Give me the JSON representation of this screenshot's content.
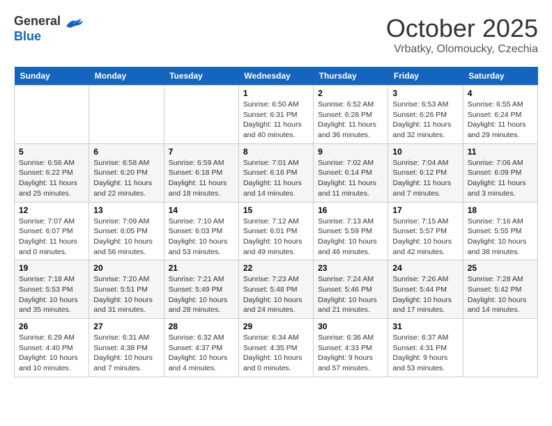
{
  "header": {
    "logo": {
      "general": "General",
      "blue": "Blue"
    },
    "title": "October 2025",
    "subtitle": "Vrbatky, Olomoucky, Czechia"
  },
  "weekdays": [
    "Sunday",
    "Monday",
    "Tuesday",
    "Wednesday",
    "Thursday",
    "Friday",
    "Saturday"
  ],
  "weeks": [
    [
      {
        "day": "",
        "info": ""
      },
      {
        "day": "",
        "info": ""
      },
      {
        "day": "",
        "info": ""
      },
      {
        "day": "1",
        "info": "Sunrise: 6:50 AM\nSunset: 6:31 PM\nDaylight: 11 hours and 40 minutes."
      },
      {
        "day": "2",
        "info": "Sunrise: 6:52 AM\nSunset: 6:28 PM\nDaylight: 11 hours and 36 minutes."
      },
      {
        "day": "3",
        "info": "Sunrise: 6:53 AM\nSunset: 6:26 PM\nDaylight: 11 hours and 32 minutes."
      },
      {
        "day": "4",
        "info": "Sunrise: 6:55 AM\nSunset: 6:24 PM\nDaylight: 11 hours and 29 minutes."
      }
    ],
    [
      {
        "day": "5",
        "info": "Sunrise: 6:56 AM\nSunset: 6:22 PM\nDaylight: 11 hours and 25 minutes."
      },
      {
        "day": "6",
        "info": "Sunrise: 6:58 AM\nSunset: 6:20 PM\nDaylight: 11 hours and 22 minutes."
      },
      {
        "day": "7",
        "info": "Sunrise: 6:59 AM\nSunset: 6:18 PM\nDaylight: 11 hours and 18 minutes."
      },
      {
        "day": "8",
        "info": "Sunrise: 7:01 AM\nSunset: 6:16 PM\nDaylight: 11 hours and 14 minutes."
      },
      {
        "day": "9",
        "info": "Sunrise: 7:02 AM\nSunset: 6:14 PM\nDaylight: 11 hours and 11 minutes."
      },
      {
        "day": "10",
        "info": "Sunrise: 7:04 AM\nSunset: 6:12 PM\nDaylight: 11 hours and 7 minutes."
      },
      {
        "day": "11",
        "info": "Sunrise: 7:06 AM\nSunset: 6:09 PM\nDaylight: 11 hours and 3 minutes."
      }
    ],
    [
      {
        "day": "12",
        "info": "Sunrise: 7:07 AM\nSunset: 6:07 PM\nDaylight: 11 hours and 0 minutes."
      },
      {
        "day": "13",
        "info": "Sunrise: 7:09 AM\nSunset: 6:05 PM\nDaylight: 10 hours and 56 minutes."
      },
      {
        "day": "14",
        "info": "Sunrise: 7:10 AM\nSunset: 6:03 PM\nDaylight: 10 hours and 53 minutes."
      },
      {
        "day": "15",
        "info": "Sunrise: 7:12 AM\nSunset: 6:01 PM\nDaylight: 10 hours and 49 minutes."
      },
      {
        "day": "16",
        "info": "Sunrise: 7:13 AM\nSunset: 5:59 PM\nDaylight: 10 hours and 46 minutes."
      },
      {
        "day": "17",
        "info": "Sunrise: 7:15 AM\nSunset: 5:57 PM\nDaylight: 10 hours and 42 minutes."
      },
      {
        "day": "18",
        "info": "Sunrise: 7:16 AM\nSunset: 5:55 PM\nDaylight: 10 hours and 38 minutes."
      }
    ],
    [
      {
        "day": "19",
        "info": "Sunrise: 7:18 AM\nSunset: 5:53 PM\nDaylight: 10 hours and 35 minutes."
      },
      {
        "day": "20",
        "info": "Sunrise: 7:20 AM\nSunset: 5:51 PM\nDaylight: 10 hours and 31 minutes."
      },
      {
        "day": "21",
        "info": "Sunrise: 7:21 AM\nSunset: 5:49 PM\nDaylight: 10 hours and 28 minutes."
      },
      {
        "day": "22",
        "info": "Sunrise: 7:23 AM\nSunset: 5:48 PM\nDaylight: 10 hours and 24 minutes."
      },
      {
        "day": "23",
        "info": "Sunrise: 7:24 AM\nSunset: 5:46 PM\nDaylight: 10 hours and 21 minutes."
      },
      {
        "day": "24",
        "info": "Sunrise: 7:26 AM\nSunset: 5:44 PM\nDaylight: 10 hours and 17 minutes."
      },
      {
        "day": "25",
        "info": "Sunrise: 7:28 AM\nSunset: 5:42 PM\nDaylight: 10 hours and 14 minutes."
      }
    ],
    [
      {
        "day": "26",
        "info": "Sunrise: 6:29 AM\nSunset: 4:40 PM\nDaylight: 10 hours and 10 minutes."
      },
      {
        "day": "27",
        "info": "Sunrise: 6:31 AM\nSunset: 4:38 PM\nDaylight: 10 hours and 7 minutes."
      },
      {
        "day": "28",
        "info": "Sunrise: 6:32 AM\nSunset: 4:37 PM\nDaylight: 10 hours and 4 minutes."
      },
      {
        "day": "29",
        "info": "Sunrise: 6:34 AM\nSunset: 4:35 PM\nDaylight: 10 hours and 0 minutes."
      },
      {
        "day": "30",
        "info": "Sunrise: 6:36 AM\nSunset: 4:33 PM\nDaylight: 9 hours and 57 minutes."
      },
      {
        "day": "31",
        "info": "Sunrise: 6:37 AM\nSunset: 4:31 PM\nDaylight: 9 hours and 53 minutes."
      },
      {
        "day": "",
        "info": ""
      }
    ]
  ]
}
